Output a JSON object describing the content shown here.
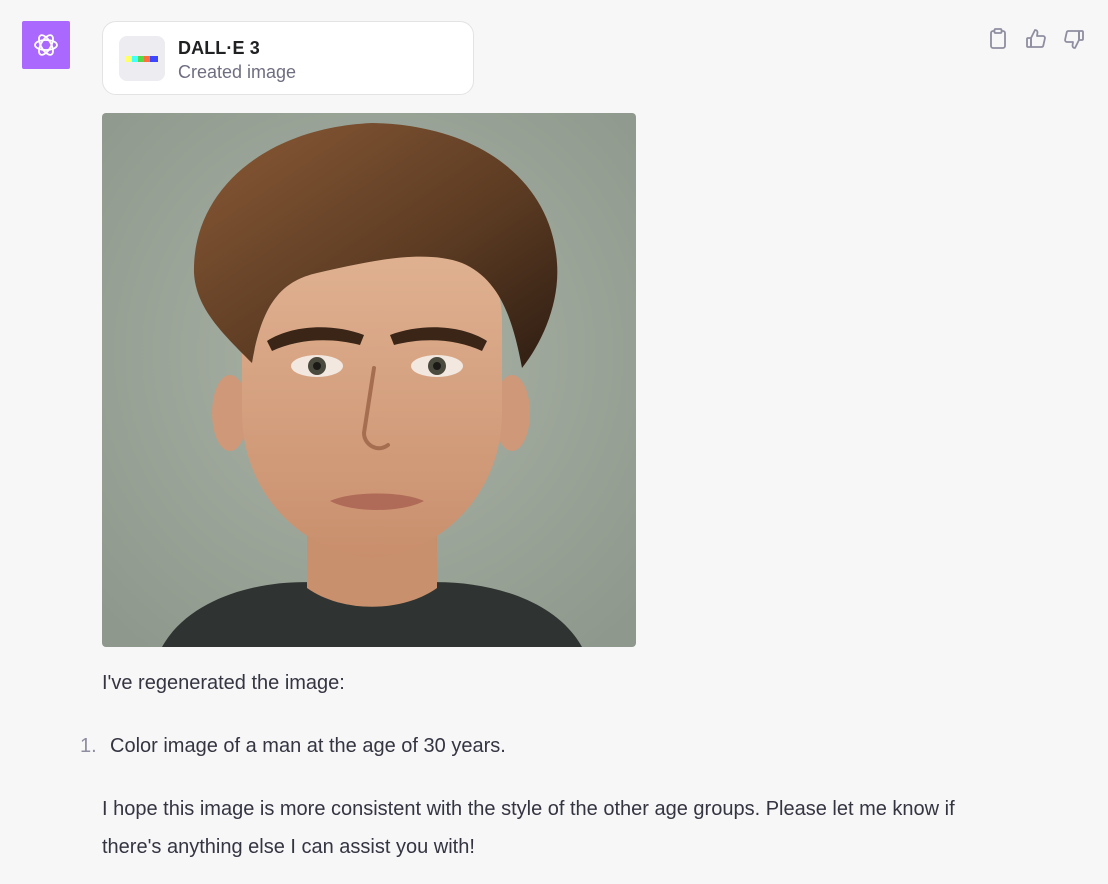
{
  "assistant": {
    "avatar_icon": "openai-logo-icon",
    "avatar_color": "#ab68ff"
  },
  "tool_card": {
    "name": "DALL·E 3",
    "status": "Created image",
    "thumb_icon": "dalle-color-strip-icon"
  },
  "actions": {
    "copy_icon": "clipboard-icon",
    "like_icon": "thumbs-up-icon",
    "dislike_icon": "thumbs-down-icon"
  },
  "message": {
    "intro": "I've regenerated the image:",
    "list": [
      {
        "number": "1.",
        "text": "Color image of a man at the age of 30 years."
      }
    ],
    "closing": "I hope this image is more consistent with the style of the other age groups. Please let me know if there's anything else I can assist you with!"
  }
}
